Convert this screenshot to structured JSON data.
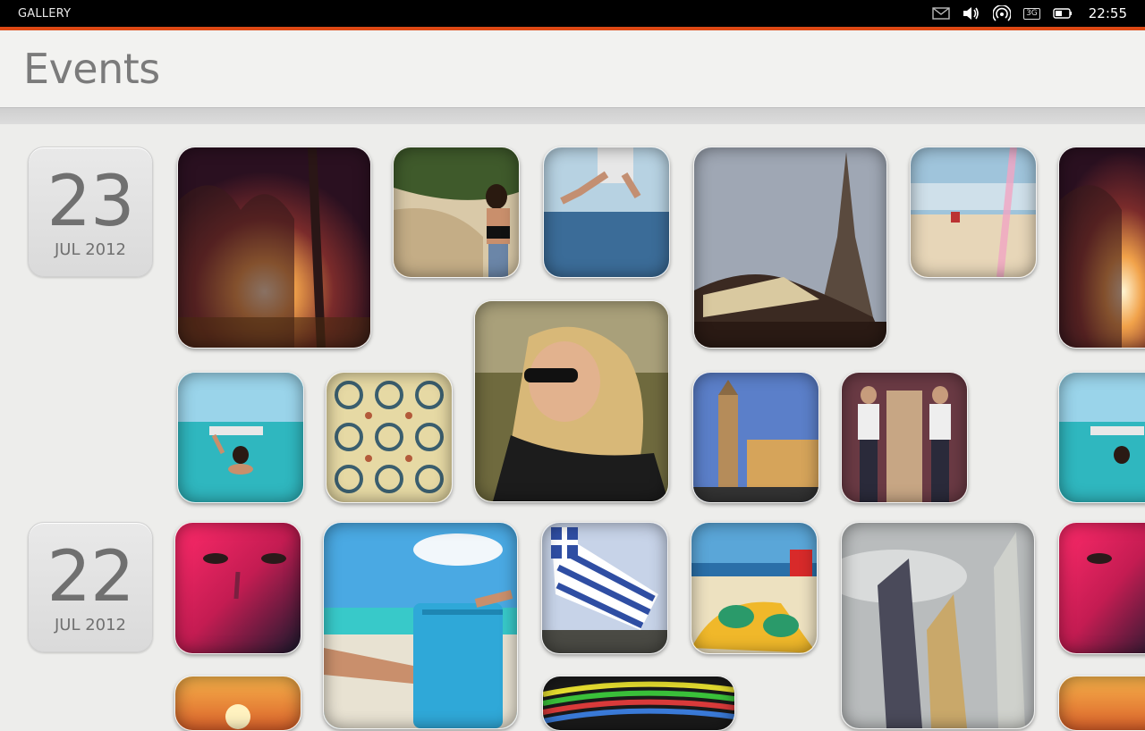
{
  "status_bar": {
    "app_name": "GALLERY",
    "network": "3G",
    "time": "22:55",
    "icons": [
      "envelope-icon",
      "volume-icon",
      "wifi-icon",
      "network-icon",
      "battery-icon"
    ]
  },
  "header": {
    "title": "Events"
  },
  "accent_color": "#dd4814",
  "events": [
    {
      "day": "23",
      "month": "JUL 2012"
    },
    {
      "day": "22",
      "month": "JUL 2012"
    }
  ],
  "photos": [
    {
      "subject": "sunset-trees"
    },
    {
      "subject": "girl-on-rocks"
    },
    {
      "subject": "jump-over-sea"
    },
    {
      "subject": "eiffel-tower-carousel"
    },
    {
      "subject": "beach-rainbow"
    },
    {
      "subject": "sunset-trees-repeat"
    },
    {
      "subject": "woman-sunglasses"
    },
    {
      "subject": "swimmer-sea"
    },
    {
      "subject": "tile-pattern"
    },
    {
      "subject": "church-tower"
    },
    {
      "subject": "man-in-mirror"
    },
    {
      "subject": "swimmer-sea-repeat"
    },
    {
      "subject": "face-portrait"
    },
    {
      "subject": "beach-chair"
    },
    {
      "subject": "greek-flag"
    },
    {
      "subject": "sunglasses-on-sand"
    },
    {
      "subject": "twin-towers"
    },
    {
      "subject": "face-portrait-repeat"
    },
    {
      "subject": "orange-sunset"
    },
    {
      "subject": "colorful-cables"
    },
    {
      "subject": "orange-sunset-repeat"
    }
  ]
}
